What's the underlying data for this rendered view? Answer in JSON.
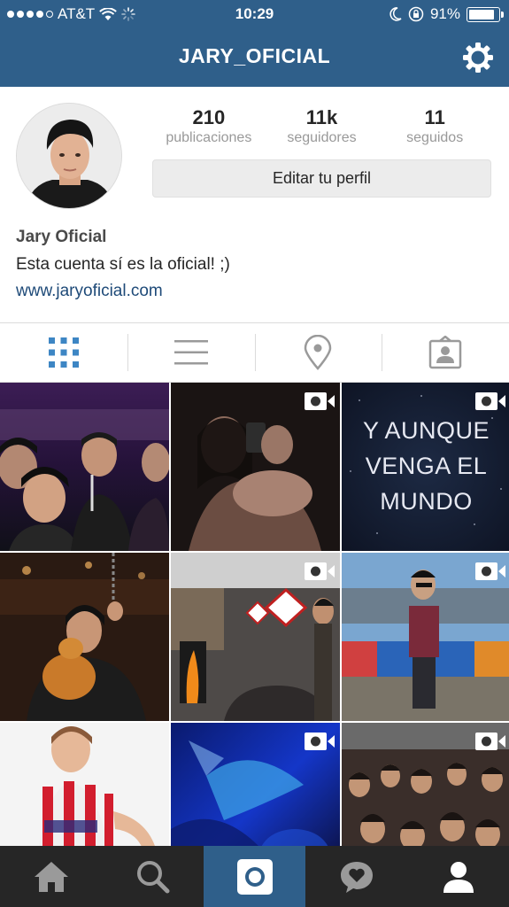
{
  "status_bar": {
    "carrier": "AT&T",
    "time": "10:29",
    "battery": "91%",
    "battery_level": 0.91,
    "signal_bars": 4
  },
  "nav": {
    "title": "JARY_OFICIAL",
    "settings_icon": "gear-icon"
  },
  "profile": {
    "stats": [
      {
        "value": "210",
        "label": "publicaciones"
      },
      {
        "value": "11k",
        "label": "seguidores"
      },
      {
        "value": "11",
        "label": "seguidos"
      }
    ],
    "edit_button": "Editar tu perfil",
    "name": "Jary Oficial",
    "bio": "Esta cuenta sí es la oficial! ;)",
    "website": "www.jaryoficial.com"
  },
  "view_tabs": [
    {
      "icon": "grid-icon",
      "active": true
    },
    {
      "icon": "list-icon",
      "active": false
    },
    {
      "icon": "location-pin-icon",
      "active": false
    },
    {
      "icon": "tagged-person-icon",
      "active": false
    }
  ],
  "grid": {
    "posts": [
      {
        "kind": "photo"
      },
      {
        "kind": "video"
      },
      {
        "kind": "video",
        "text_lines": [
          "Y AUNQUE",
          "VENGA EL",
          "MUNDO"
        ]
      },
      {
        "kind": "photo"
      },
      {
        "kind": "video"
      },
      {
        "kind": "video"
      },
      {
        "kind": "photo"
      },
      {
        "kind": "video"
      },
      {
        "kind": "video"
      }
    ]
  },
  "tab_bar": [
    {
      "icon": "home-icon",
      "active": false
    },
    {
      "icon": "search-icon",
      "active": false
    },
    {
      "icon": "camera-icon",
      "active": true
    },
    {
      "icon": "activity-heart-icon",
      "active": false
    },
    {
      "icon": "profile-icon",
      "active": false
    }
  ],
  "colors": {
    "header_blue": "#2f5f8a",
    "link_blue": "#1e4a78",
    "tab_active_blue": "#3d86c4",
    "tabbar_dark": "#262626"
  }
}
